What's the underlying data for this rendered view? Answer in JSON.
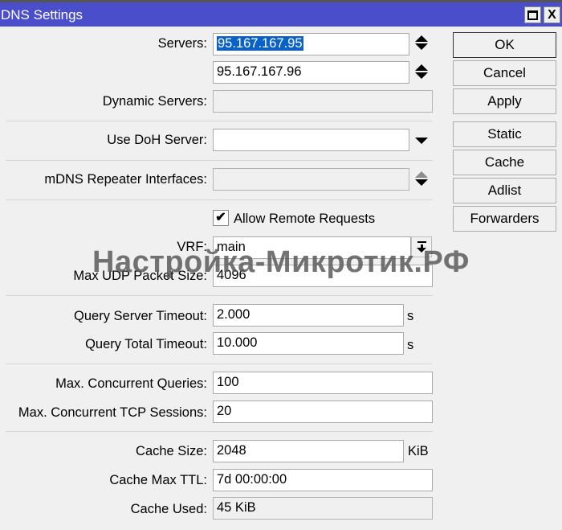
{
  "window": {
    "title": "DNS Settings",
    "maximize_icon": "maximize-icon",
    "close_icon": "close-icon",
    "close_glyph": "X"
  },
  "fields": {
    "servers": {
      "label": "Servers:",
      "values": [
        "95.167.167.95",
        "95.167.167.96"
      ]
    },
    "dynamic_servers": {
      "label": "Dynamic Servers:",
      "value": ""
    },
    "use_doh_server": {
      "label": "Use DoH Server:",
      "value": ""
    },
    "mdns_repeater": {
      "label": "mDNS Repeater Interfaces:",
      "value": ""
    },
    "allow_remote": {
      "label": "Allow Remote Requests",
      "checked": true,
      "check_glyph": "✔"
    },
    "vrf": {
      "label": "VRF:",
      "value": "main"
    },
    "max_udp": {
      "label": "Max UDP Packet Size:",
      "value": "4096"
    },
    "query_server_timeout": {
      "label": "Query Server Timeout:",
      "value": "2.000",
      "unit": "s"
    },
    "query_total_timeout": {
      "label": "Query Total Timeout:",
      "value": "10.000",
      "unit": "s"
    },
    "max_concurrent_queries": {
      "label": "Max. Concurrent Queries:",
      "value": "100"
    },
    "max_concurrent_tcp": {
      "label": "Max. Concurrent TCP Sessions:",
      "value": "20"
    },
    "cache_size": {
      "label": "Cache Size:",
      "value": "2048",
      "unit": "KiB"
    },
    "cache_max_ttl": {
      "label": "Cache Max TTL:",
      "value": "7d 00:00:00"
    },
    "cache_used": {
      "label": "Cache Used:",
      "value": "45 KiB"
    }
  },
  "buttons": {
    "ok": "OK",
    "cancel": "Cancel",
    "apply": "Apply",
    "static": "Static",
    "cache": "Cache",
    "adlist": "Adlist",
    "forwarders": "Forwarders"
  },
  "watermark": "Настройка-Микротик.РФ"
}
